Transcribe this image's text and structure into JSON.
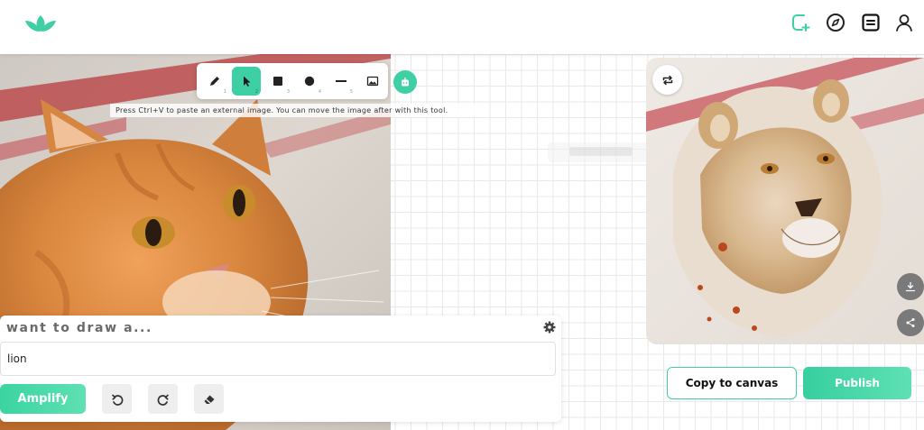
{
  "header": {
    "logo": "leaf-logo",
    "icons": [
      "add-canvas-icon",
      "compass-icon",
      "document-icon",
      "user-icon"
    ],
    "accent": "#3fcfa5"
  },
  "toolbar": {
    "tools": [
      {
        "icon": "pencil-icon",
        "key": "1"
      },
      {
        "icon": "cursor-icon",
        "key": "2",
        "active": true
      },
      {
        "icon": "square-icon",
        "key": "3"
      },
      {
        "icon": "circle-icon",
        "key": "4"
      },
      {
        "icon": "line-icon",
        "key": "5"
      },
      {
        "icon": "image-icon",
        "key": ""
      }
    ],
    "hint": "Press Ctrl+V to paste an external image. You can move the image after with this tool."
  },
  "prompt": {
    "heading": "want to draw a...",
    "value": "lion",
    "amplify_label": "Amplify"
  },
  "result": {
    "copy_label": "Copy to canvas",
    "publish_label": "Publish"
  }
}
